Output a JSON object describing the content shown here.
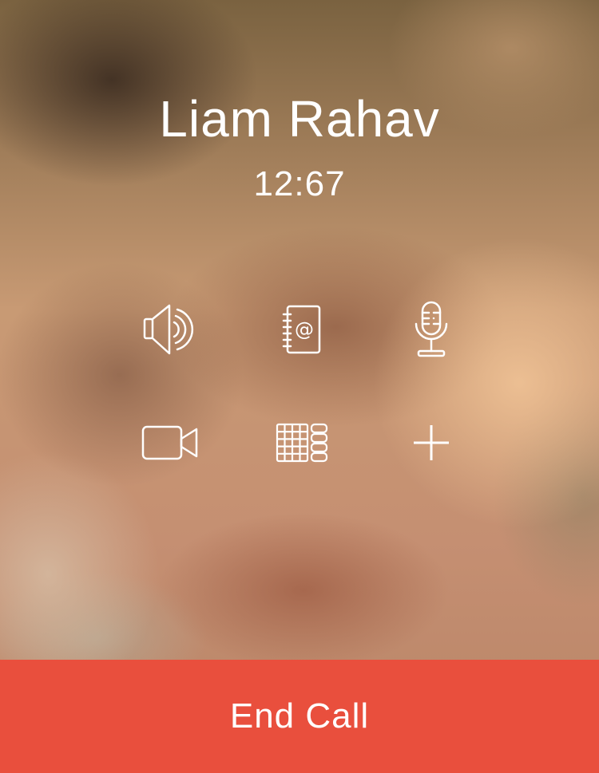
{
  "call": {
    "caller_name": "Liam Rahav",
    "timer": "12:67"
  },
  "controls": [
    {
      "name": "speaker",
      "icon": "speaker-icon"
    },
    {
      "name": "contacts",
      "icon": "address-book-icon"
    },
    {
      "name": "microphone",
      "icon": "microphone-icon"
    },
    {
      "name": "video",
      "icon": "video-camera-icon"
    },
    {
      "name": "keypad",
      "icon": "keypad-icon"
    },
    {
      "name": "add-call",
      "icon": "plus-icon"
    }
  ],
  "end_call": {
    "label": "End Call",
    "color": "#e94f3d"
  },
  "colors": {
    "foreground": "#ffffff"
  }
}
